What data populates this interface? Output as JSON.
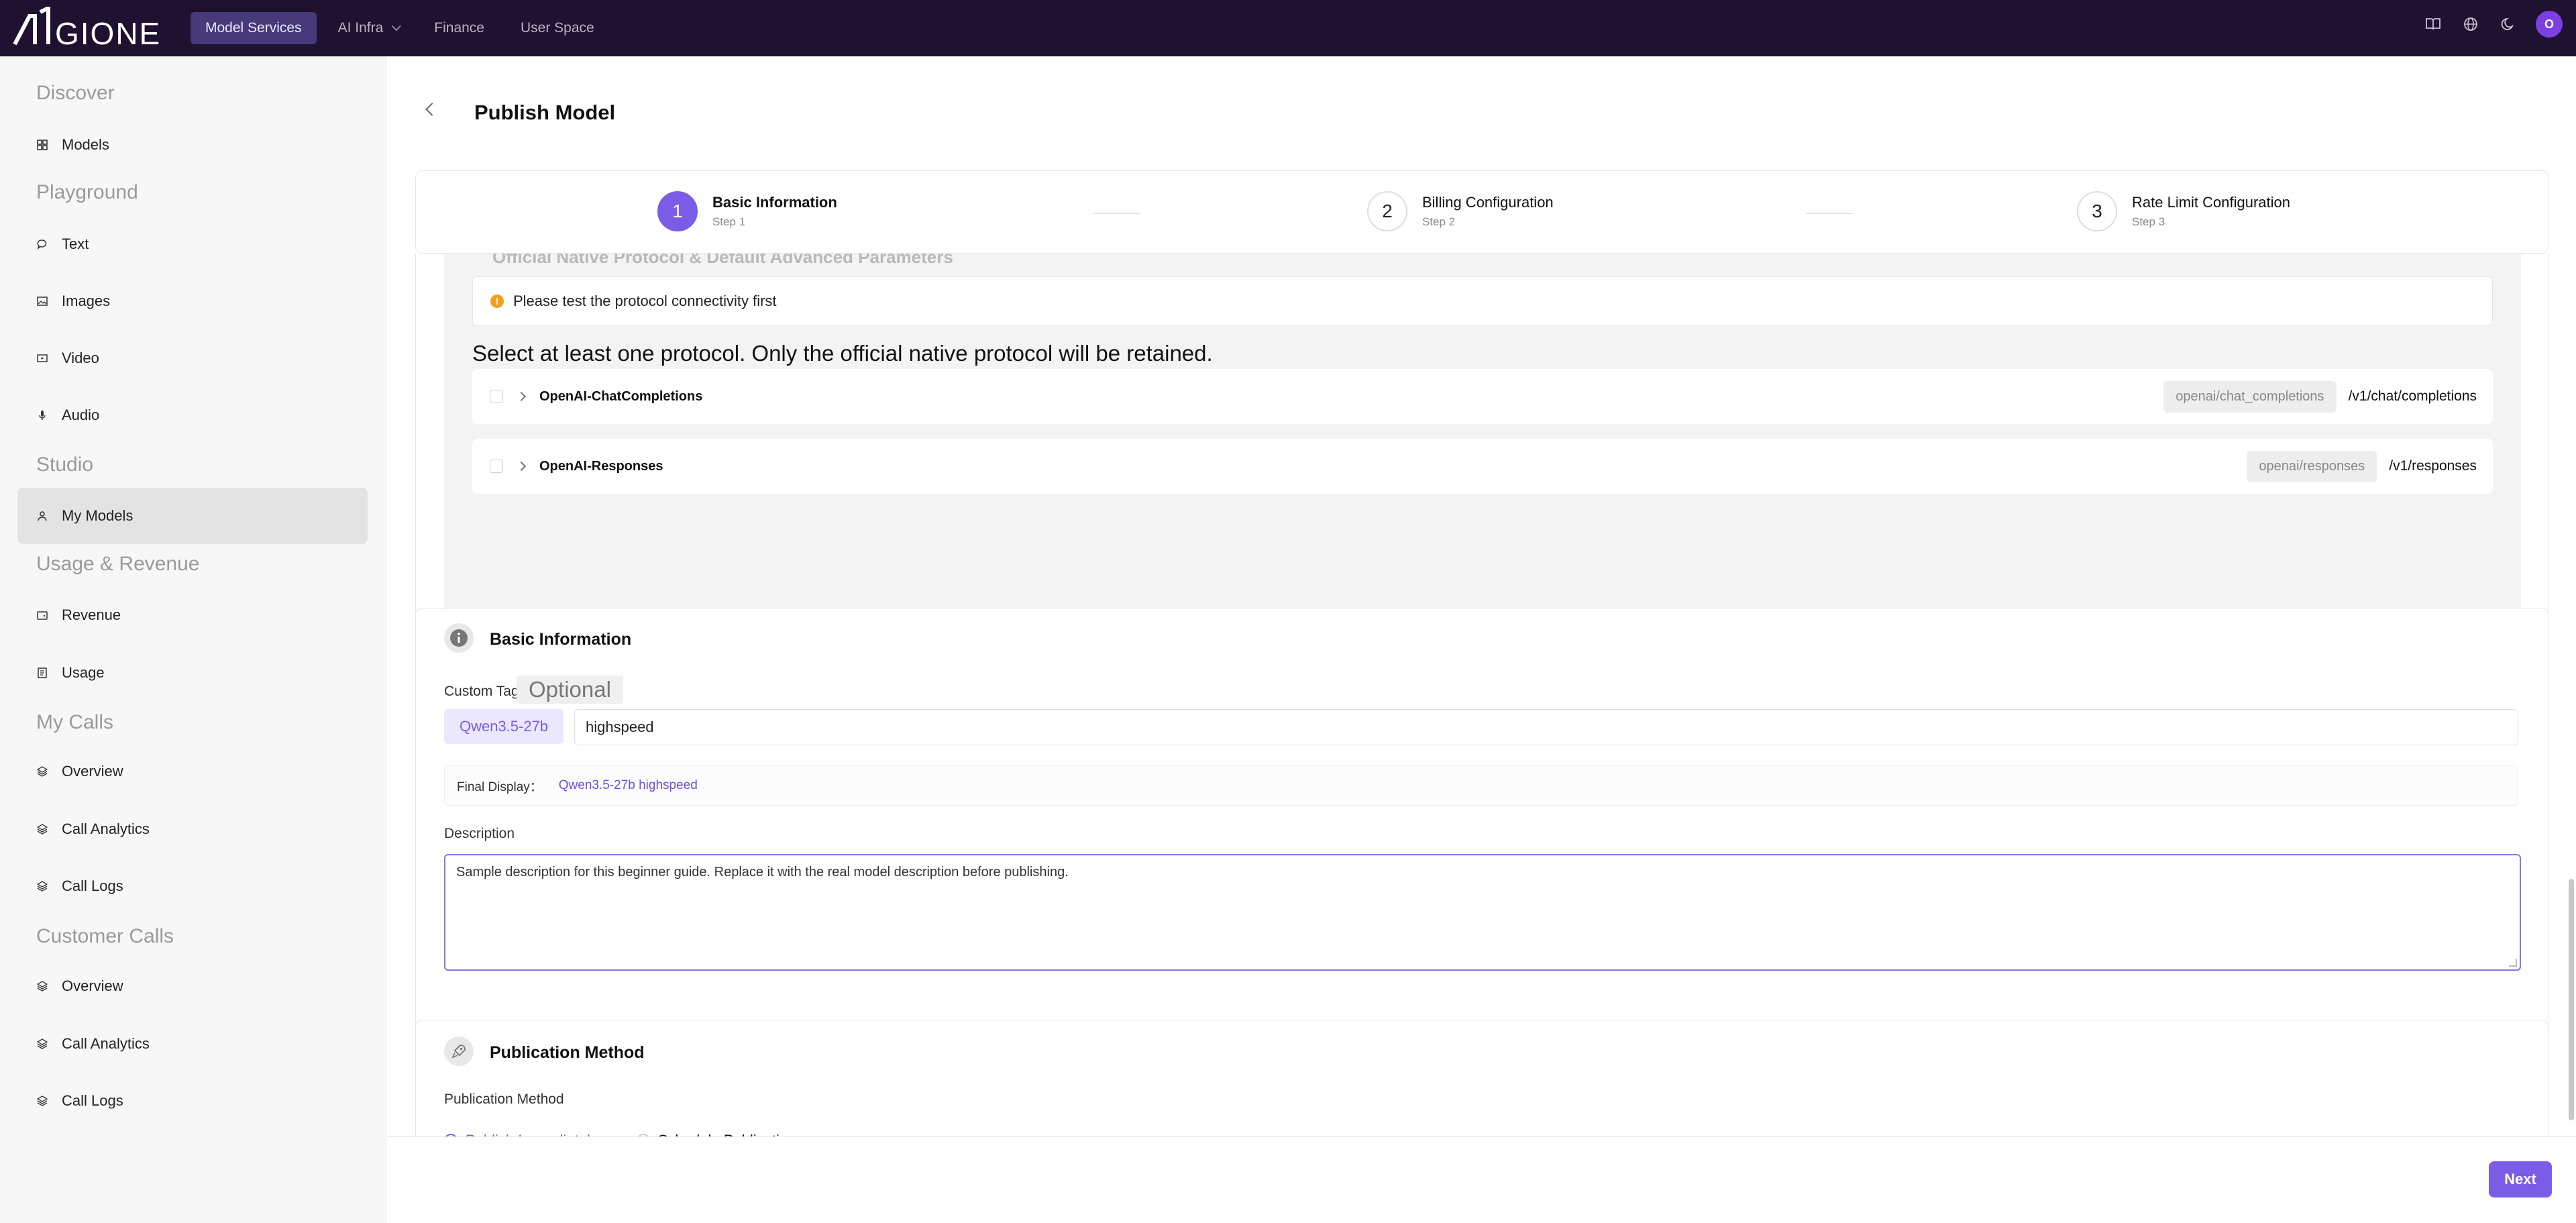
{
  "header": {
    "logo_text": "AIGIONE",
    "nav": [
      {
        "label": "Model Services"
      },
      {
        "label": "AI Infra"
      },
      {
        "label": "Finance"
      },
      {
        "label": "User Space"
      }
    ],
    "avatar_initial": "O"
  },
  "sidebar": {
    "groups": {
      "discover": "Discover",
      "playground": "Playground",
      "studio": "Studio",
      "usage_revenue": "Usage & Revenue",
      "my_calls": "My Calls",
      "customer_calls": "Customer Calls"
    },
    "items": {
      "models": "Models",
      "text": "Text",
      "images": "Images",
      "video": "Video",
      "audio": "Audio",
      "my_models": "My Models",
      "revenue": "Revenue",
      "usage": "Usage",
      "my_overview": "Overview",
      "my_call_analytics": "Call Analytics",
      "my_call_logs": "Call Logs",
      "cust_overview": "Overview",
      "cust_call_analytics": "Call Analytics",
      "cust_call_logs": "Call Logs"
    }
  },
  "page": {
    "title": "Publish Model"
  },
  "steps": [
    {
      "num": "1",
      "title": "Basic Information",
      "sub": "Step 1"
    },
    {
      "num": "2",
      "title": "Billing Configuration",
      "sub": "Step 2"
    },
    {
      "num": "3",
      "title": "Rate Limit Configuration",
      "sub": "Step 3"
    }
  ],
  "protocol": {
    "section_title": "Official Native Protocol & Default Advanced Parameters",
    "warning": "Please test the protocol connectivity first",
    "select_note": "Select at least one protocol. Only the official native protocol will be retained.",
    "rows": [
      {
        "name": "OpenAI-ChatCompletions",
        "tag": "openai/chat_completions",
        "path": "/v1/chat/completions"
      },
      {
        "name": "OpenAI-Responses",
        "tag": "openai/responses",
        "path": "/v1/responses"
      }
    ]
  },
  "basic": {
    "title": "Basic Information",
    "custom_tag_label": "Custom Tag",
    "optional": "Optional",
    "prefix": "Qwen3.5-27b",
    "tag_value": "highspeed",
    "final_label": "Final Display：",
    "final_value": "Qwen3.5-27b highspeed",
    "description_label": "Description",
    "description_value": "Sample description for this beginner guide. Replace it with the real model description before publishing."
  },
  "publication": {
    "title": "Publication Method",
    "label": "Publication Method",
    "options": [
      "Publish Immediately",
      "Schedule Publication"
    ]
  },
  "footer": {
    "next": "Next"
  },
  "colors": {
    "accent": "#7b5ce6",
    "topbar": "#1f1130"
  }
}
